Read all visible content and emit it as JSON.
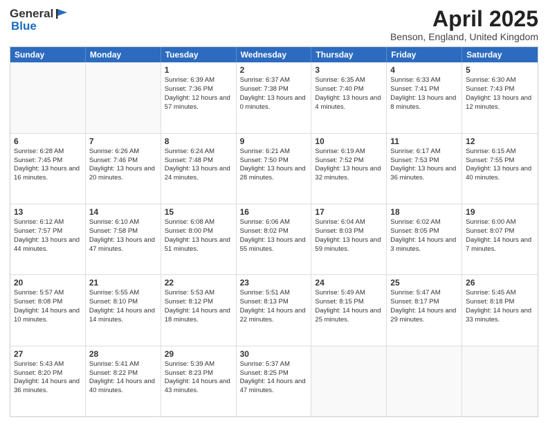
{
  "header": {
    "logo_line1": "General",
    "logo_line2": "Blue",
    "title": "April 2025",
    "location": "Benson, England, United Kingdom"
  },
  "days_of_week": [
    "Sunday",
    "Monday",
    "Tuesday",
    "Wednesday",
    "Thursday",
    "Friday",
    "Saturday"
  ],
  "weeks": [
    [
      {
        "day": "",
        "empty": true
      },
      {
        "day": "",
        "empty": true
      },
      {
        "day": "1",
        "sunrise": "Sunrise: 6:39 AM",
        "sunset": "Sunset: 7:36 PM",
        "daylight": "Daylight: 12 hours and 57 minutes."
      },
      {
        "day": "2",
        "sunrise": "Sunrise: 6:37 AM",
        "sunset": "Sunset: 7:38 PM",
        "daylight": "Daylight: 13 hours and 0 minutes."
      },
      {
        "day": "3",
        "sunrise": "Sunrise: 6:35 AM",
        "sunset": "Sunset: 7:40 PM",
        "daylight": "Daylight: 13 hours and 4 minutes."
      },
      {
        "day": "4",
        "sunrise": "Sunrise: 6:33 AM",
        "sunset": "Sunset: 7:41 PM",
        "daylight": "Daylight: 13 hours and 8 minutes."
      },
      {
        "day": "5",
        "sunrise": "Sunrise: 6:30 AM",
        "sunset": "Sunset: 7:43 PM",
        "daylight": "Daylight: 13 hours and 12 minutes."
      }
    ],
    [
      {
        "day": "6",
        "sunrise": "Sunrise: 6:28 AM",
        "sunset": "Sunset: 7:45 PM",
        "daylight": "Daylight: 13 hours and 16 minutes."
      },
      {
        "day": "7",
        "sunrise": "Sunrise: 6:26 AM",
        "sunset": "Sunset: 7:46 PM",
        "daylight": "Daylight: 13 hours and 20 minutes."
      },
      {
        "day": "8",
        "sunrise": "Sunrise: 6:24 AM",
        "sunset": "Sunset: 7:48 PM",
        "daylight": "Daylight: 13 hours and 24 minutes."
      },
      {
        "day": "9",
        "sunrise": "Sunrise: 6:21 AM",
        "sunset": "Sunset: 7:50 PM",
        "daylight": "Daylight: 13 hours and 28 minutes."
      },
      {
        "day": "10",
        "sunrise": "Sunrise: 6:19 AM",
        "sunset": "Sunset: 7:52 PM",
        "daylight": "Daylight: 13 hours and 32 minutes."
      },
      {
        "day": "11",
        "sunrise": "Sunrise: 6:17 AM",
        "sunset": "Sunset: 7:53 PM",
        "daylight": "Daylight: 13 hours and 36 minutes."
      },
      {
        "day": "12",
        "sunrise": "Sunrise: 6:15 AM",
        "sunset": "Sunset: 7:55 PM",
        "daylight": "Daylight: 13 hours and 40 minutes."
      }
    ],
    [
      {
        "day": "13",
        "sunrise": "Sunrise: 6:12 AM",
        "sunset": "Sunset: 7:57 PM",
        "daylight": "Daylight: 13 hours and 44 minutes."
      },
      {
        "day": "14",
        "sunrise": "Sunrise: 6:10 AM",
        "sunset": "Sunset: 7:58 PM",
        "daylight": "Daylight: 13 hours and 47 minutes."
      },
      {
        "day": "15",
        "sunrise": "Sunrise: 6:08 AM",
        "sunset": "Sunset: 8:00 PM",
        "daylight": "Daylight: 13 hours and 51 minutes."
      },
      {
        "day": "16",
        "sunrise": "Sunrise: 6:06 AM",
        "sunset": "Sunset: 8:02 PM",
        "daylight": "Daylight: 13 hours and 55 minutes."
      },
      {
        "day": "17",
        "sunrise": "Sunrise: 6:04 AM",
        "sunset": "Sunset: 8:03 PM",
        "daylight": "Daylight: 13 hours and 59 minutes."
      },
      {
        "day": "18",
        "sunrise": "Sunrise: 6:02 AM",
        "sunset": "Sunset: 8:05 PM",
        "daylight": "Daylight: 14 hours and 3 minutes."
      },
      {
        "day": "19",
        "sunrise": "Sunrise: 6:00 AM",
        "sunset": "Sunset: 8:07 PM",
        "daylight": "Daylight: 14 hours and 7 minutes."
      }
    ],
    [
      {
        "day": "20",
        "sunrise": "Sunrise: 5:57 AM",
        "sunset": "Sunset: 8:08 PM",
        "daylight": "Daylight: 14 hours and 10 minutes."
      },
      {
        "day": "21",
        "sunrise": "Sunrise: 5:55 AM",
        "sunset": "Sunset: 8:10 PM",
        "daylight": "Daylight: 14 hours and 14 minutes."
      },
      {
        "day": "22",
        "sunrise": "Sunrise: 5:53 AM",
        "sunset": "Sunset: 8:12 PM",
        "daylight": "Daylight: 14 hours and 18 minutes."
      },
      {
        "day": "23",
        "sunrise": "Sunrise: 5:51 AM",
        "sunset": "Sunset: 8:13 PM",
        "daylight": "Daylight: 14 hours and 22 minutes."
      },
      {
        "day": "24",
        "sunrise": "Sunrise: 5:49 AM",
        "sunset": "Sunset: 8:15 PM",
        "daylight": "Daylight: 14 hours and 25 minutes."
      },
      {
        "day": "25",
        "sunrise": "Sunrise: 5:47 AM",
        "sunset": "Sunset: 8:17 PM",
        "daylight": "Daylight: 14 hours and 29 minutes."
      },
      {
        "day": "26",
        "sunrise": "Sunrise: 5:45 AM",
        "sunset": "Sunset: 8:18 PM",
        "daylight": "Daylight: 14 hours and 33 minutes."
      }
    ],
    [
      {
        "day": "27",
        "sunrise": "Sunrise: 5:43 AM",
        "sunset": "Sunset: 8:20 PM",
        "daylight": "Daylight: 14 hours and 36 minutes."
      },
      {
        "day": "28",
        "sunrise": "Sunrise: 5:41 AM",
        "sunset": "Sunset: 8:22 PM",
        "daylight": "Daylight: 14 hours and 40 minutes."
      },
      {
        "day": "29",
        "sunrise": "Sunrise: 5:39 AM",
        "sunset": "Sunset: 8:23 PM",
        "daylight": "Daylight: 14 hours and 43 minutes."
      },
      {
        "day": "30",
        "sunrise": "Sunrise: 5:37 AM",
        "sunset": "Sunset: 8:25 PM",
        "daylight": "Daylight: 14 hours and 47 minutes."
      },
      {
        "day": "",
        "empty": true
      },
      {
        "day": "",
        "empty": true
      },
      {
        "day": "",
        "empty": true
      }
    ]
  ]
}
